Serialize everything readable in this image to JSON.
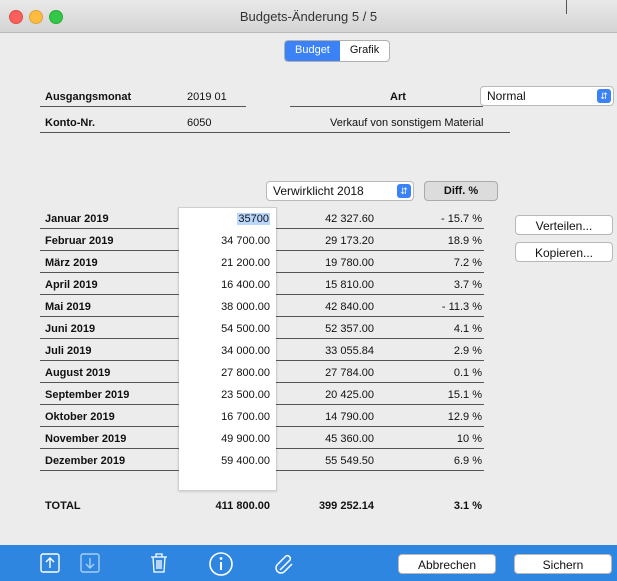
{
  "window": {
    "title": "Budgets-Änderung  5 / 5"
  },
  "tabs": {
    "budget": "Budget",
    "grafik": "Grafik"
  },
  "header": {
    "ausgangsmonat_label": "Ausgangsmonat",
    "ausgangsmonat_value": "2019 01",
    "art_label": "Art",
    "art_value": "Normal",
    "konto_label": "Konto-Nr.",
    "konto_value": "6050",
    "konto_desc": "Verkauf von sonstigem Material"
  },
  "table": {
    "compare_select": "Verwirklicht 2018",
    "diff_button": "Diff. %",
    "rows": [
      {
        "month": "Januar 2019",
        "budget": "35700",
        "actual": "42 327.60",
        "diff": "- 15.7 %"
      },
      {
        "month": "Februar 2019",
        "budget": "34 700.00",
        "actual": "29 173.20",
        "diff": "18.9 %"
      },
      {
        "month": "März 2019",
        "budget": "21 200.00",
        "actual": "19 780.00",
        "diff": "7.2 %"
      },
      {
        "month": "April 2019",
        "budget": "16 400.00",
        "actual": "15 810.00",
        "diff": "3.7 %"
      },
      {
        "month": "Mai 2019",
        "budget": "38 000.00",
        "actual": "42 840.00",
        "diff": "- 11.3 %"
      },
      {
        "month": "Juni 2019",
        "budget": "54 500.00",
        "actual": "52 357.00",
        "diff": "4.1 %"
      },
      {
        "month": "Juli 2019",
        "budget": "34 000.00",
        "actual": "33 055.84",
        "diff": "2.9 %"
      },
      {
        "month": "August 2019",
        "budget": "27 800.00",
        "actual": "27 784.00",
        "diff": "0.1 %"
      },
      {
        "month": "September 2019",
        "budget": "23 500.00",
        "actual": "20 425.00",
        "diff": "15.1 %"
      },
      {
        "month": "Oktober 2019",
        "budget": "16 700.00",
        "actual": "14 790.00",
        "diff": "12.9 %"
      },
      {
        "month": "November 2019",
        "budget": "49 900.00",
        "actual": "45 360.00",
        "diff": "10 %"
      },
      {
        "month": "Dezember 2019",
        "budget": "59 400.00",
        "actual": "55 549.50",
        "diff": "6.9 %"
      }
    ],
    "total": {
      "month": "TOTAL",
      "budget": "411 800.00",
      "actual": "399 252.14",
      "diff": "3.1 %"
    }
  },
  "side_buttons": {
    "verteilen": "Verteilen...",
    "kopieren": "Kopieren..."
  },
  "footer": {
    "cancel": "Abbrechen",
    "save": "Sichern"
  },
  "icons": {
    "export": "export-icon",
    "import": "import-icon",
    "trash": "trash-icon",
    "info": "info-icon",
    "attachment": "paperclip-icon"
  },
  "colors": {
    "accent": "#3b82f7",
    "bottom_bar": "#2e86e0",
    "selection": "#b9d6fb"
  }
}
